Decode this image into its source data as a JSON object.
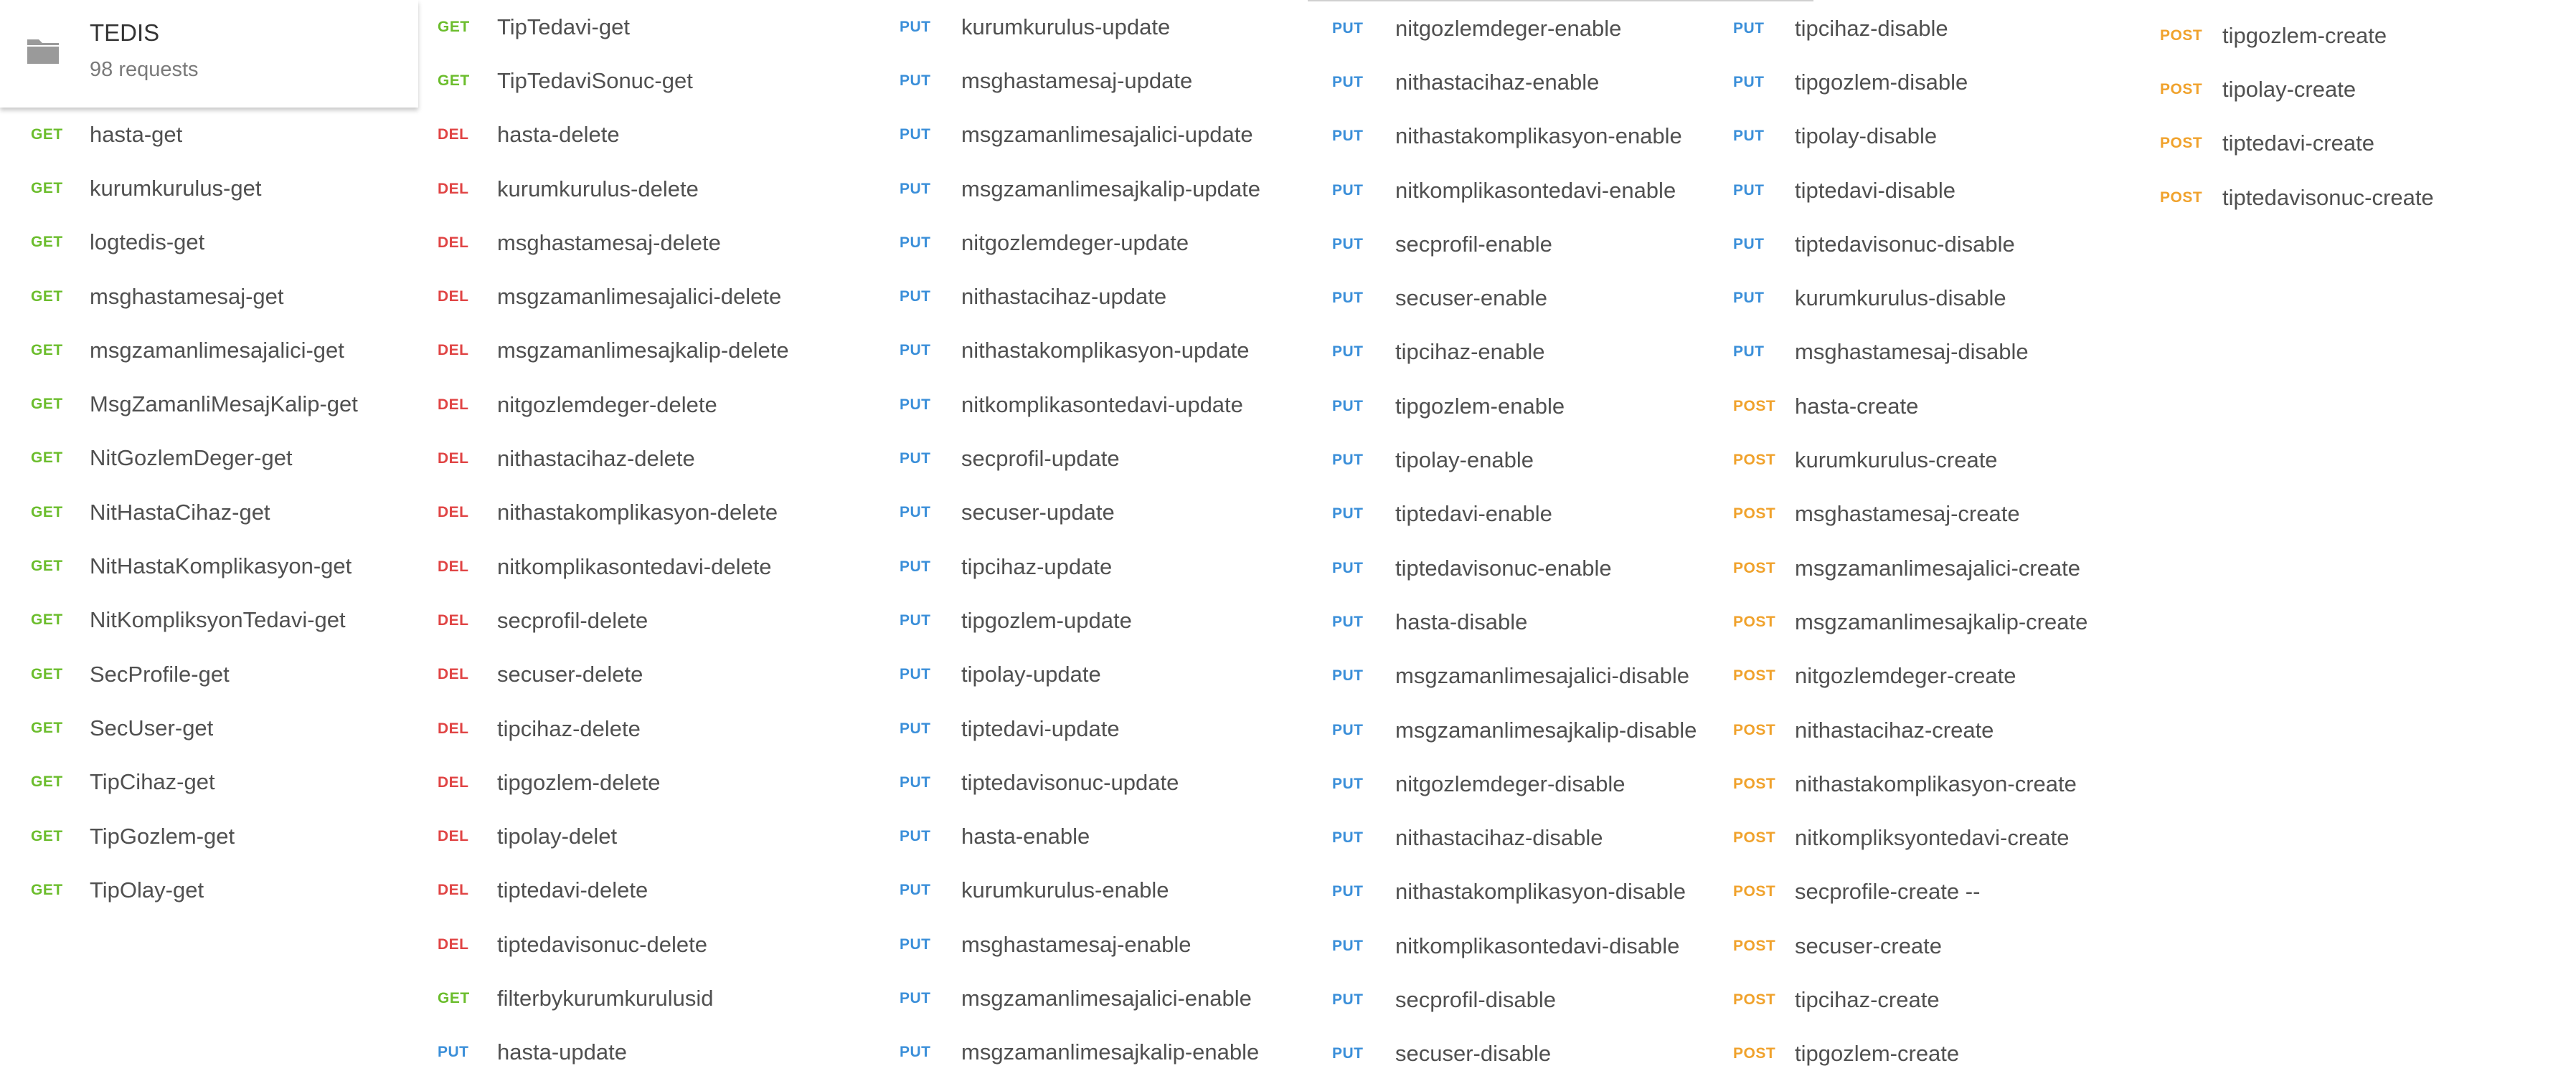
{
  "collection": {
    "title": "TEDIS",
    "count": "98 requests",
    "icon": "folder-icon"
  },
  "method_colors": {
    "GET": "#6bbd2c",
    "PUT": "#3b8fd9",
    "DEL": "#e04444",
    "POST": "#f0a22c"
  },
  "columns": [
    {
      "items": [
        {
          "method": "GET",
          "name": "hasta-get"
        },
        {
          "method": "GET",
          "name": "kurumkurulus-get"
        },
        {
          "method": "GET",
          "name": "logtedis-get"
        },
        {
          "method": "GET",
          "name": "msghastamesaj-get"
        },
        {
          "method": "GET",
          "name": "msgzamanlimesajalici-get"
        },
        {
          "method": "GET",
          "name": "MsgZamanliMesajKalip-get"
        },
        {
          "method": "GET",
          "name": "NitGozlemDeger-get"
        },
        {
          "method": "GET",
          "name": "NitHastaCihaz-get"
        },
        {
          "method": "GET",
          "name": "NitHastaKomplikasyon-get"
        },
        {
          "method": "GET",
          "name": "NitKompliksyonTedavi-get"
        },
        {
          "method": "GET",
          "name": "SecProfile-get"
        },
        {
          "method": "GET",
          "name": "SecUser-get"
        },
        {
          "method": "GET",
          "name": "TipCihaz-get"
        },
        {
          "method": "GET",
          "name": "TipGozlem-get"
        },
        {
          "method": "GET",
          "name": "TipOlay-get"
        }
      ]
    },
    {
      "items": [
        {
          "method": "GET",
          "name": "TipTedavi-get"
        },
        {
          "method": "GET",
          "name": "TipTedaviSonuc-get"
        },
        {
          "method": "DEL",
          "name": "hasta-delete"
        },
        {
          "method": "DEL",
          "name": "kurumkurulus-delete"
        },
        {
          "method": "DEL",
          "name": "msghastamesaj-delete"
        },
        {
          "method": "DEL",
          "name": "msgzamanlimesajalici-delete"
        },
        {
          "method": "DEL",
          "name": "msgzamanlimesajkalip-delete"
        },
        {
          "method": "DEL",
          "name": "nitgozlemdeger-delete"
        },
        {
          "method": "DEL",
          "name": "nithastacihaz-delete"
        },
        {
          "method": "DEL",
          "name": "nithastakomplikasyon-delete"
        },
        {
          "method": "DEL",
          "name": "nitkomplikasontedavi-delete"
        },
        {
          "method": "DEL",
          "name": "secprofil-delete"
        },
        {
          "method": "DEL",
          "name": "secuser-delete"
        },
        {
          "method": "DEL",
          "name": "tipcihaz-delete"
        },
        {
          "method": "DEL",
          "name": "tipgozlem-delete"
        },
        {
          "method": "DEL",
          "name": "tipolay-delet"
        },
        {
          "method": "DEL",
          "name": "tiptedavi-delete"
        },
        {
          "method": "DEL",
          "name": "tiptedavisonuc-delete"
        },
        {
          "method": "GET",
          "name": "filterbykurumkurulusid"
        },
        {
          "method": "PUT",
          "name": "hasta-update"
        }
      ]
    },
    {
      "items": [
        {
          "method": "PUT",
          "name": "kurumkurulus-update"
        },
        {
          "method": "PUT",
          "name": "msghastamesaj-update"
        },
        {
          "method": "PUT",
          "name": "msgzamanlimesajalici-update"
        },
        {
          "method": "PUT",
          "name": "msgzamanlimesajkalip-update"
        },
        {
          "method": "PUT",
          "name": "nitgozlemdeger-update"
        },
        {
          "method": "PUT",
          "name": "nithastacihaz-update"
        },
        {
          "method": "PUT",
          "name": "nithastakomplikasyon-update"
        },
        {
          "method": "PUT",
          "name": "nitkomplikasontedavi-update"
        },
        {
          "method": "PUT",
          "name": "secprofil-update"
        },
        {
          "method": "PUT",
          "name": "secuser-update"
        },
        {
          "method": "PUT",
          "name": "tipcihaz-update"
        },
        {
          "method": "PUT",
          "name": "tipgozlem-update"
        },
        {
          "method": "PUT",
          "name": "tipolay-update"
        },
        {
          "method": "PUT",
          "name": "tiptedavi-update"
        },
        {
          "method": "PUT",
          "name": "tiptedavisonuc-update"
        },
        {
          "method": "PUT",
          "name": "hasta-enable"
        },
        {
          "method": "PUT",
          "name": "kurumkurulus-enable"
        },
        {
          "method": "PUT",
          "name": "msghastamesaj-enable"
        },
        {
          "method": "PUT",
          "name": "msgzamanlimesajalici-enable"
        },
        {
          "method": "PUT",
          "name": "msgzamanlimesajkalip-enable"
        }
      ]
    },
    {
      "items": [
        {
          "method": "PUT",
          "name": "nitgozlemdeger-enable"
        },
        {
          "method": "PUT",
          "name": "nithastacihaz-enable"
        },
        {
          "method": "PUT",
          "name": "nithastakomplikasyon-enable"
        },
        {
          "method": "PUT",
          "name": "nitkomplikasontedavi-enable"
        },
        {
          "method": "PUT",
          "name": "secprofil-enable"
        },
        {
          "method": "PUT",
          "name": "secuser-enable"
        },
        {
          "method": "PUT",
          "name": "tipcihaz-enable"
        },
        {
          "method": "PUT",
          "name": "tipgozlem-enable"
        },
        {
          "method": "PUT",
          "name": "tipolay-enable"
        },
        {
          "method": "PUT",
          "name": "tiptedavi-enable"
        },
        {
          "method": "PUT",
          "name": "tiptedavisonuc-enable"
        },
        {
          "method": "PUT",
          "name": "hasta-disable"
        },
        {
          "method": "PUT",
          "name": "msgzamanlimesajalici-disable"
        },
        {
          "method": "PUT",
          "name": "msgzamanlimesajkalip-disable"
        },
        {
          "method": "PUT",
          "name": "nitgozlemdeger-disable"
        },
        {
          "method": "PUT",
          "name": "nithastacihaz-disable"
        },
        {
          "method": "PUT",
          "name": "nithastakomplikasyon-disable"
        },
        {
          "method": "PUT",
          "name": "nitkomplikasontedavi-disable"
        },
        {
          "method": "PUT",
          "name": "secprofil-disable"
        },
        {
          "method": "PUT",
          "name": "secuser-disable"
        }
      ]
    },
    {
      "items": [
        {
          "method": "PUT",
          "name": "tipcihaz-disable"
        },
        {
          "method": "PUT",
          "name": "tipgozlem-disable"
        },
        {
          "method": "PUT",
          "name": "tipolay-disable"
        },
        {
          "method": "PUT",
          "name": "tiptedavi-disable"
        },
        {
          "method": "PUT",
          "name": "tiptedavisonuc-disable"
        },
        {
          "method": "PUT",
          "name": "kurumkurulus-disable"
        },
        {
          "method": "PUT",
          "name": "msghastamesaj-disable"
        },
        {
          "method": "POST",
          "name": "hasta-create"
        },
        {
          "method": "POST",
          "name": "kurumkurulus-create"
        },
        {
          "method": "POST",
          "name": "msghastamesaj-create"
        },
        {
          "method": "POST",
          "name": "msgzamanlimesajalici-create"
        },
        {
          "method": "POST",
          "name": "msgzamanlimesajkalip-create"
        },
        {
          "method": "POST",
          "name": "nitgozlemdeger-create"
        },
        {
          "method": "POST",
          "name": "nithastacihaz-create"
        },
        {
          "method": "POST",
          "name": "nithastakomplikasyon-create"
        },
        {
          "method": "POST",
          "name": "nitkompliksyontedavi-create"
        },
        {
          "method": "POST",
          "name": "secprofile-create --"
        },
        {
          "method": "POST",
          "name": "secuser-create"
        },
        {
          "method": "POST",
          "name": "tipcihaz-create"
        },
        {
          "method": "POST",
          "name": "tipgozlem-create"
        }
      ]
    },
    {
      "items": [
        {
          "method": "POST",
          "name": "tipgozlem-create"
        },
        {
          "method": "POST",
          "name": "tipolay-create"
        },
        {
          "method": "POST",
          "name": "tiptedavi-create"
        },
        {
          "method": "POST",
          "name": "tiptedavisonuc-create"
        }
      ]
    }
  ]
}
